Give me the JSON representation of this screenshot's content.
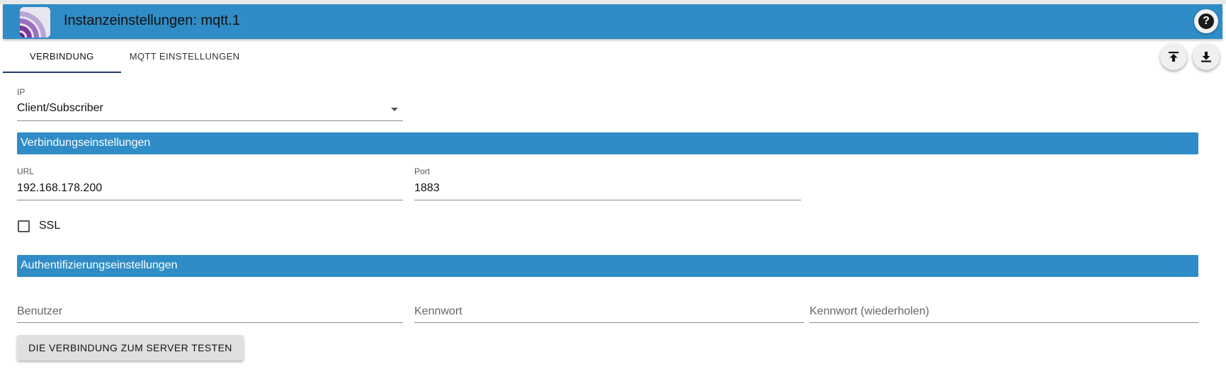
{
  "header": {
    "title": "Instanzeinstellungen: mqtt.1",
    "help_icon": "question-circle-icon",
    "help_glyph": "?",
    "logo_icon": "mqtt-logo-icon",
    "background_color": "#2f8cc6"
  },
  "tabs": [
    {
      "label": "VERBINDUNG",
      "active": true
    },
    {
      "label": "MQTT EINSTELLUNGEN",
      "active": false
    }
  ],
  "toolbar": {
    "upload_icon": "upload-to-top-icon",
    "download_icon": "download-icon"
  },
  "form": {
    "type_select": {
      "label": "IP",
      "value": "Client/Subscriber"
    },
    "connection_section": {
      "title": "Verbindungseinstellungen"
    },
    "url": {
      "label": "URL",
      "value": "192.168.178.200"
    },
    "port": {
      "label": "Port",
      "value": "1883"
    },
    "ssl": {
      "label": "SSL",
      "checked": false
    },
    "auth_section": {
      "title": "Authentifizierungseinstellungen"
    },
    "user": {
      "placeholder": "Benutzer",
      "value": ""
    },
    "password": {
      "placeholder": "Kennwort",
      "value": ""
    },
    "password_repeat": {
      "placeholder": "Kennwort (wiederholen)",
      "value": ""
    },
    "test_button_label": "DIE VERBINDUNG ZUM SERVER TESTEN"
  },
  "colors": {
    "accent": "#2f8cc6",
    "tab_indicator": "#1e3a6e"
  }
}
